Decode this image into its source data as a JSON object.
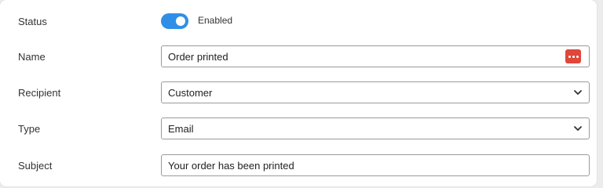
{
  "form": {
    "status": {
      "label": "Status",
      "toggle_on": true,
      "toggle_text": "Enabled"
    },
    "name": {
      "label": "Name",
      "value": "Order printed",
      "icon": "password-manager-icon"
    },
    "recipient": {
      "label": "Recipient",
      "value": "Customer",
      "icon": "chevron-down-icon"
    },
    "type": {
      "label": "Type",
      "value": "Email",
      "icon": "chevron-down-icon"
    },
    "subject": {
      "label": "Subject",
      "value": "Your order has been printed"
    }
  },
  "colors": {
    "accent": "#2f8fe7",
    "icon_red": "#e0463a"
  }
}
